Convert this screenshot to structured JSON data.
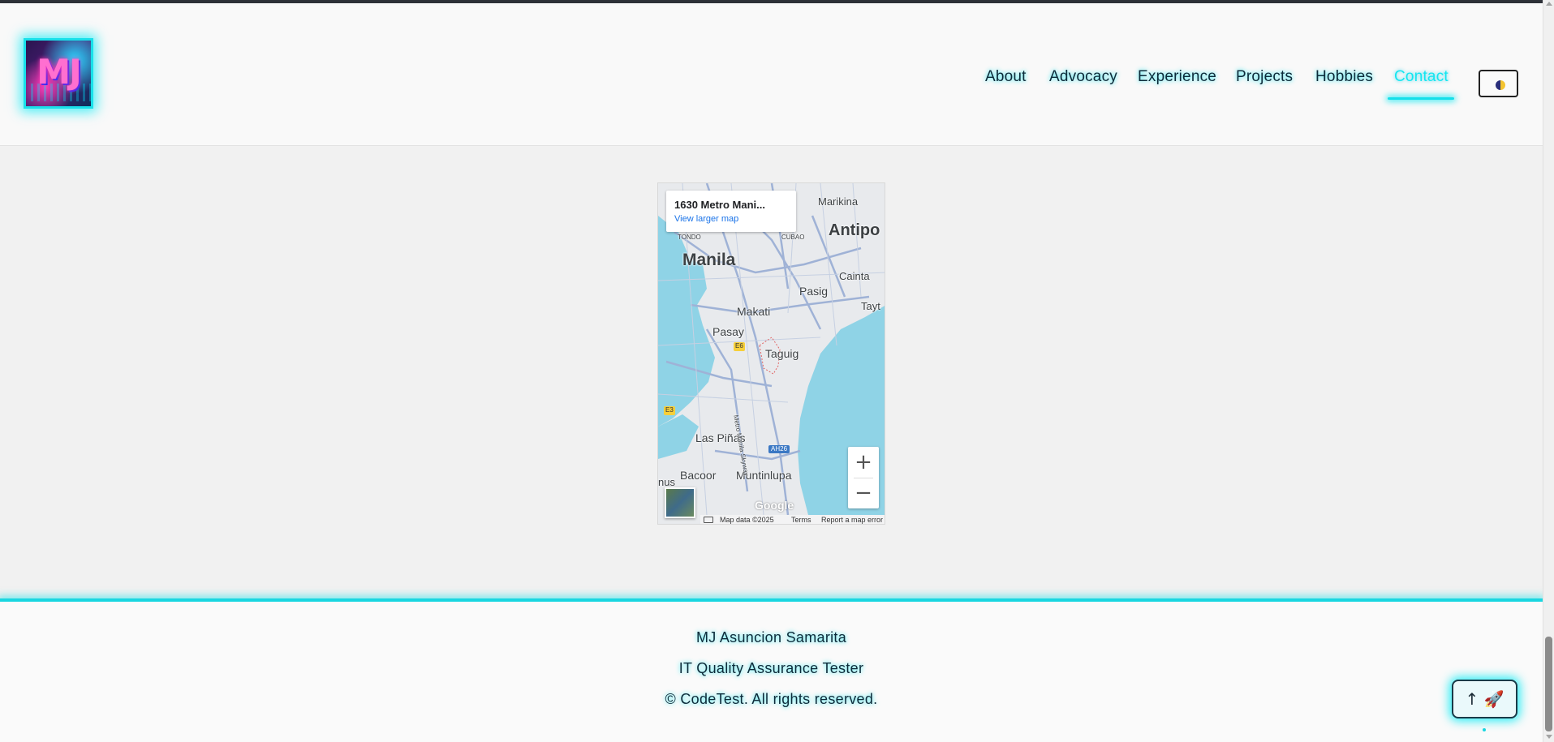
{
  "header": {
    "logo_text": "MJ",
    "nav": [
      {
        "label": "About",
        "active": false
      },
      {
        "label": "Advocacy",
        "active": false
      },
      {
        "label": "Experience",
        "active": false
      },
      {
        "label": "Projects",
        "active": false
      },
      {
        "label": "Hobbies",
        "active": false
      },
      {
        "label": "Contact",
        "active": true
      }
    ],
    "theme_toggle_icon": "half-moon-icon"
  },
  "map": {
    "place_title": "1630 Metro Mani...",
    "view_larger_link": "View larger map",
    "labels": {
      "manila": "Manila",
      "marikina": "Marikina",
      "antipolo": "Antipo",
      "cainta": "Cainta",
      "pasig": "Pasig",
      "taytay": "Tayt",
      "makati": "Makati",
      "pasay": "Pasay",
      "taguig": "Taguig",
      "tondo": "TONDO",
      "cubao": "CUBAO",
      "las_pinas": "Las Piñas",
      "bacoor": "Bacoor",
      "muntinlupa": "Muntinlupa",
      "nus": "nus",
      "skyway": "Metro Manila Skyway",
      "e6": "E6",
      "e3": "E3",
      "ah26": "AH26"
    },
    "zoom_in": "+",
    "zoom_out": "−",
    "google_logo": "Google",
    "footer": {
      "map_data": "Map data ©2025",
      "terms": "Terms",
      "report": "Report a map error"
    }
  },
  "footer": {
    "name": "MJ Asuncion Samarita",
    "role": "IT Quality Assurance Tester",
    "copyright": "© CodeTest. All rights reserved."
  },
  "back_to_top": {
    "label": "↑ 🚀"
  },
  "colors": {
    "accent": "#19d6e0",
    "text": "#0d2b3a",
    "page_bg": "#f1f1f1",
    "header_bg": "#f9f9f9",
    "water": "#8fd3e6"
  }
}
